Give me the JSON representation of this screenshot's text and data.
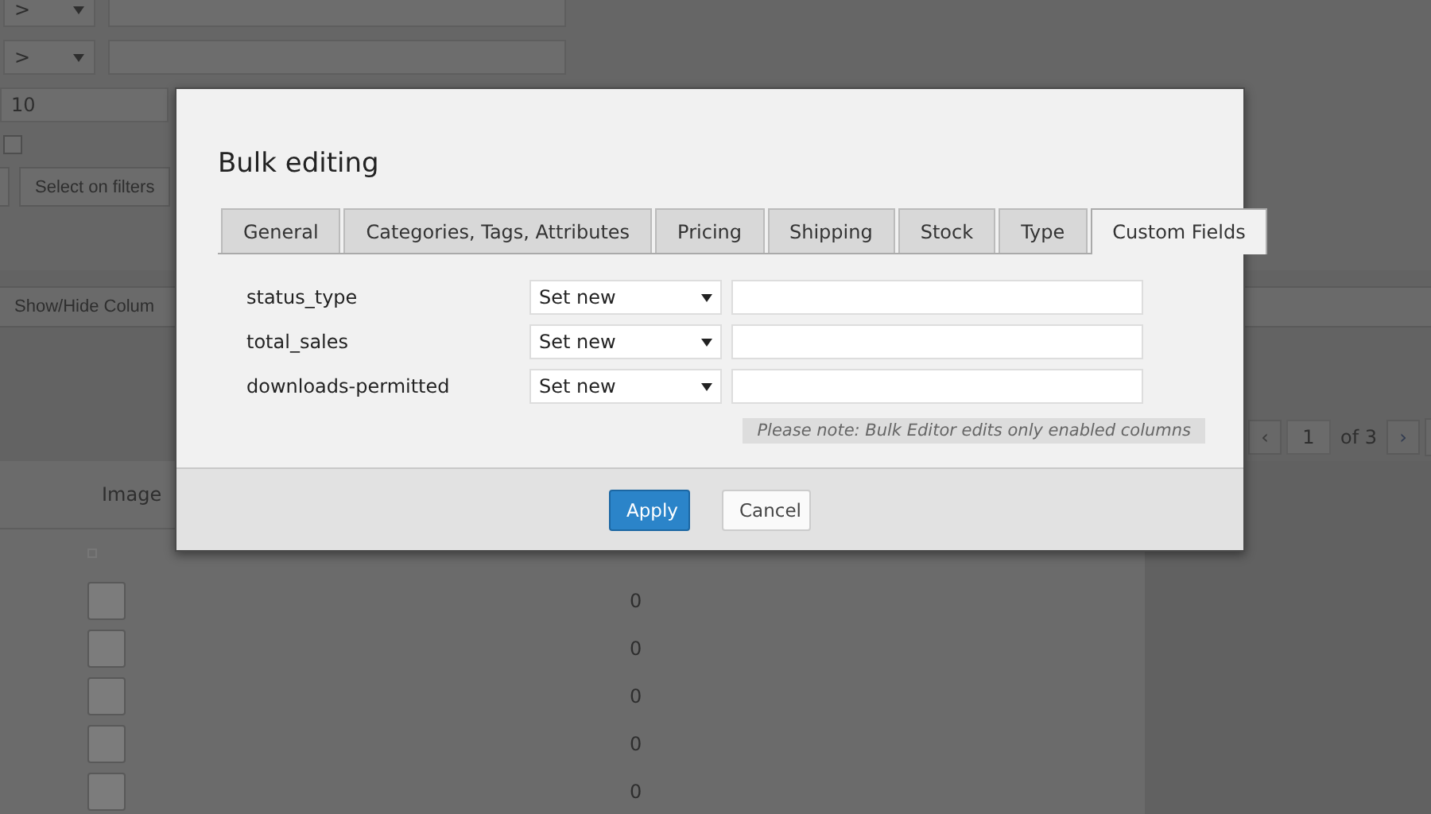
{
  "filters": {
    "rows": [
      {
        "operator": ">"
      },
      {
        "operator": ">"
      }
    ],
    "number_field": "10",
    "checkbox": {
      "checked": false
    },
    "button": "Select on filters"
  },
  "columns_button": "Show/Hide Colum",
  "pagination": {
    "prev": "‹",
    "page": "1",
    "of": "of 3",
    "next": "›"
  },
  "table": {
    "columns": [
      "Image"
    ],
    "rows": [
      {
        "column_2": "0"
      },
      {
        "column_2": "0"
      },
      {
        "column_2": "0"
      },
      {
        "column_2": "0"
      },
      {
        "column_2": "0"
      }
    ]
  },
  "dialog": {
    "title": "Bulk editing",
    "tabs": [
      {
        "label": "General",
        "selected": false
      },
      {
        "label": "Categories, Tags, Attributes",
        "selected": false
      },
      {
        "label": "Pricing",
        "selected": false
      },
      {
        "label": "Shipping",
        "selected": false
      },
      {
        "label": "Stock",
        "selected": false
      },
      {
        "label": "Type",
        "selected": false
      },
      {
        "label": "Custom Fields",
        "selected": true
      }
    ],
    "fields": [
      {
        "name": "status_type",
        "mode": "Set new"
      },
      {
        "name": "total_sales",
        "mode": "Set new"
      },
      {
        "name": "downloads-permitted",
        "mode": "Set new"
      }
    ],
    "note": "Please note: Bulk Editor edits only enabled columns",
    "buttons": [
      {
        "label": "Apply",
        "kind": "primary"
      },
      {
        "label": "Cancel",
        "kind": "secondary"
      }
    ]
  }
}
